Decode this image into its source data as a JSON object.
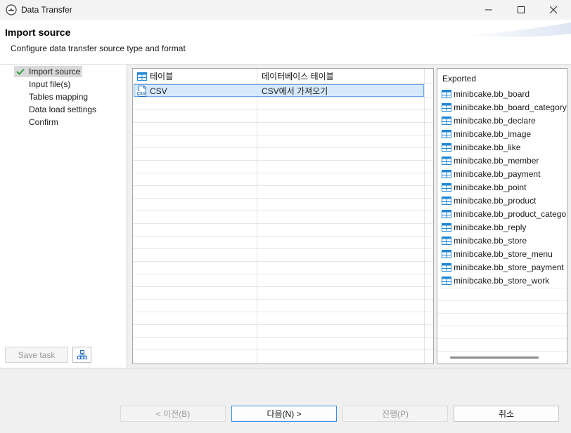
{
  "window": {
    "title": "Data Transfer"
  },
  "header": {
    "title": "Import source",
    "description": "Configure data transfer source type and format"
  },
  "nav": {
    "items": [
      {
        "label": "Import source",
        "active": true
      },
      {
        "label": "Input file(s)"
      },
      {
        "label": "Tables mapping"
      },
      {
        "label": "Data load settings"
      },
      {
        "label": "Confirm"
      }
    ],
    "save_task_label": "Save task"
  },
  "source_table": {
    "columns": [
      "테이블",
      "데이터베이스 테이블"
    ],
    "rows": [
      {
        "name": "CSV",
        "description": "CSV에서 가져오기",
        "icon": "csv-file-icon",
        "selected": true
      }
    ]
  },
  "exported": {
    "header": "Exported",
    "items": [
      "minibcake.bb_board",
      "minibcake.bb_board_category",
      "minibcake.bb_declare",
      "minibcake.bb_image",
      "minibcake.bb_like",
      "minibcake.bb_member",
      "minibcake.bb_payment",
      "minibcake.bb_point",
      "minibcake.bb_product",
      "minibcake.bb_product_catego",
      "minibcake.bb_reply",
      "minibcake.bb_store",
      "minibcake.bb_store_menu",
      "minibcake.bb_store_payment",
      "minibcake.bb_store_work"
    ]
  },
  "footer": {
    "back_label": "< 이전(B)",
    "next_label": "다음(N) >",
    "finish_label": "진행(P)",
    "cancel_label": "취소"
  },
  "colors": {
    "selection": "#d6e8fb",
    "selection_border": "#6aa5e3",
    "table_icon": "#1e88d6",
    "check": "#2e9e44",
    "primary_border": "#3c8de4"
  }
}
